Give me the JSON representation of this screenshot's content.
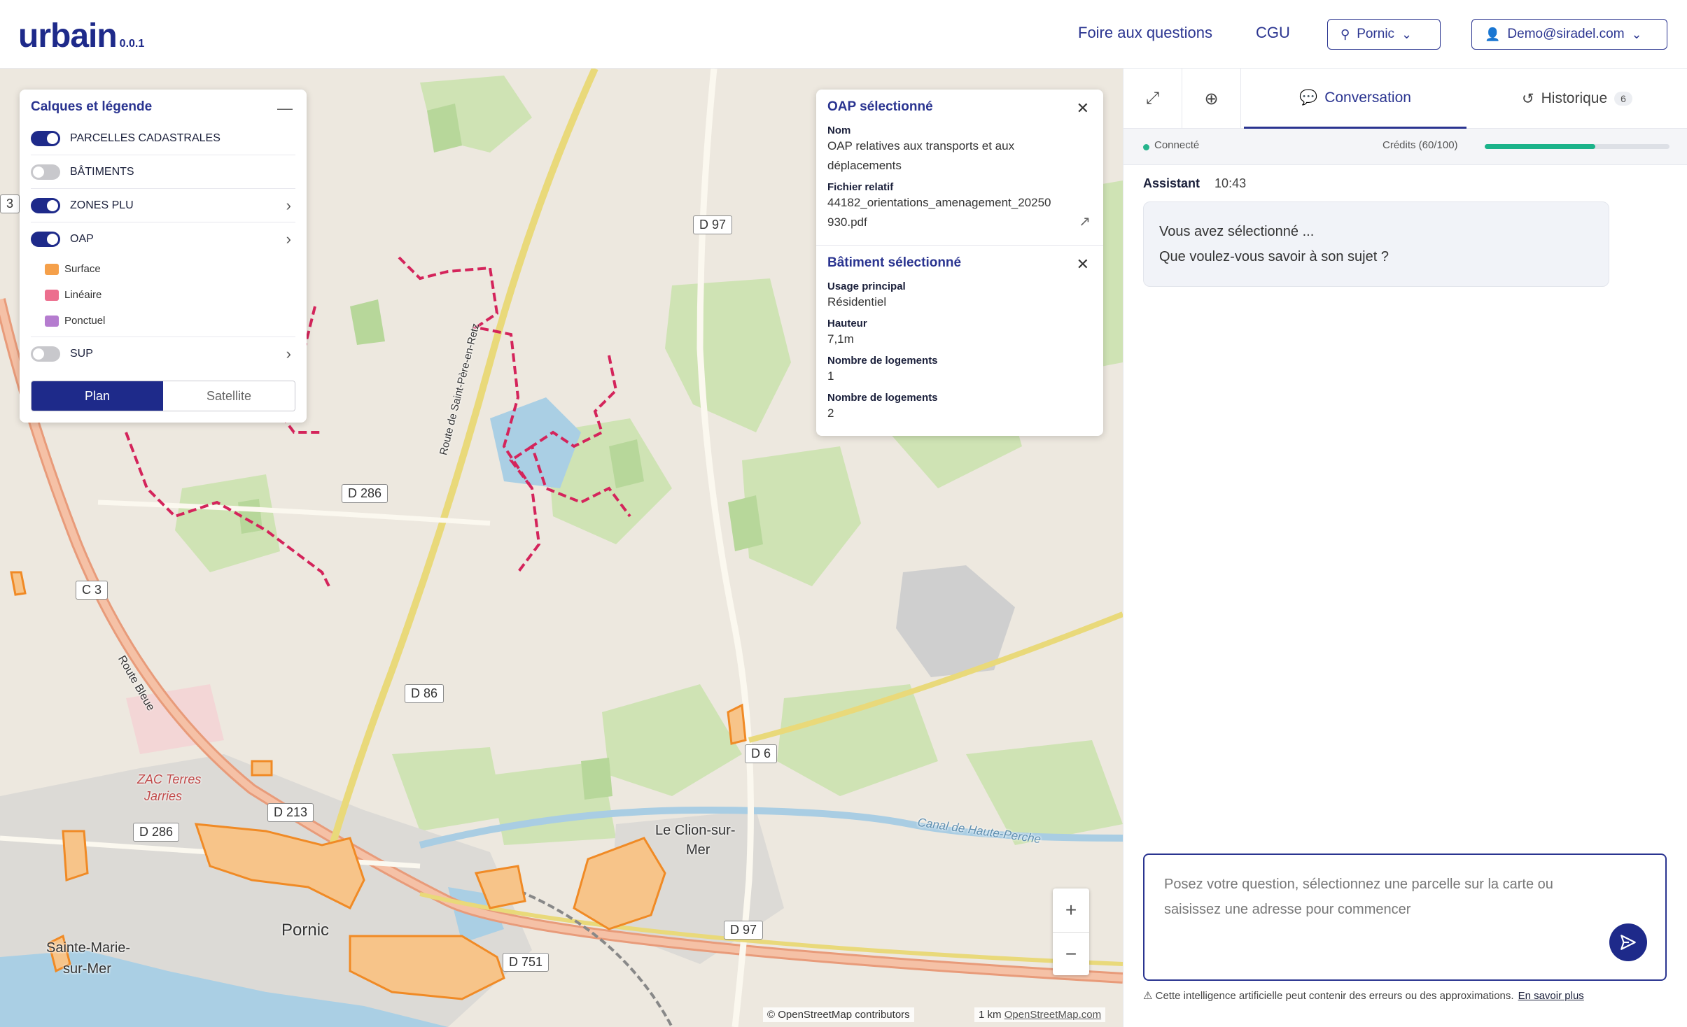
{
  "header": {
    "logo": "urbain",
    "version": "0.0.1",
    "links": {
      "faq": "Foire aux questions",
      "cgu": "CGU"
    },
    "location_select": "Pornic",
    "user_menu": "Demo@siradel.com"
  },
  "layers": {
    "title": "Calques et légende",
    "items": [
      {
        "label": "PARCELLES CADASTRALES",
        "on": true
      },
      {
        "label": "BÂTIMENTS",
        "on": false
      },
      {
        "label": "ZONES PLU",
        "on": true
      },
      {
        "label": "OAP",
        "on": true
      },
      {
        "label": "SUP",
        "on": false
      }
    ],
    "legend": [
      {
        "label": "Surface",
        "color": "#f5a04a"
      },
      {
        "label": "Linéaire",
        "color": "#ec6f8e"
      },
      {
        "label": "Ponctuel",
        "color": "#b57ccf"
      }
    ],
    "basemap": {
      "plan": "Plan",
      "satellite": "Satellite",
      "selected": "Plan"
    }
  },
  "info": {
    "oap": {
      "title": "OAP sélectionné",
      "nom_label": "Nom",
      "nom_value": "OAP relatives aux transports et aux déplacements",
      "fichier_label": "Fichier relatif",
      "fichier_value": "44182_orientations_amenagement_20250930.pdf"
    },
    "batiment": {
      "title": "Bâtiment sélectionné",
      "usage_label": "Usage principal",
      "usage_value": "Résidentiel",
      "hauteur_label": "Hauteur",
      "hauteur_value": "7,1m",
      "logements1_label": "Nombre de logements",
      "logements1_value": "1",
      "logements2_label": "Nombre de logements",
      "logements2_value": "2"
    }
  },
  "map": {
    "roads": [
      "D 97",
      "D 286",
      "C 3",
      "D 86",
      "D 6",
      "D 213",
      "D 286",
      "D 97",
      "D 751",
      "3"
    ],
    "places": [
      "Pornic",
      "Sainte-Marie-",
      "sur-Mer",
      "Le Clion-sur-",
      "Mer",
      "ZAC Terres",
      "Jarries",
      "Canal de Haute-Perche",
      "Route Bleue",
      "Route de Saint-Père-en-Retz"
    ],
    "attribution": "© OpenStreetMap contributors",
    "scale": "1 km",
    "scale_link": "OpenStreetMap.com",
    "zoom_in": "+",
    "zoom_out": "−"
  },
  "panel": {
    "tabs": {
      "conversation": "Conversation",
      "historique": "Historique",
      "historique_count": "6",
      "active": "conversation"
    },
    "status": "Connecté",
    "credits_label": "Crédits (60/100)",
    "credits_fraction": 0.6,
    "message": {
      "author": "Assistant",
      "time": "10:43",
      "line1": "Vous avez sélectionné ...",
      "line2": "Que voulez-vous savoir à son sujet ?"
    },
    "composer_placeholder": "Posez votre question, sélectionnez une parcelle sur la carte ou saisissez une adresse pour commencer",
    "disclaimer": "Cette intelligence artificielle peut contenir des erreurs ou des approximations.",
    "disclaimer_link": "En savoir plus"
  },
  "colors": {
    "brand": "#1e2a8a",
    "accent_green": "#1bb38a",
    "oap_line": "#d4245b",
    "oap_surface": "#f5a04a"
  }
}
